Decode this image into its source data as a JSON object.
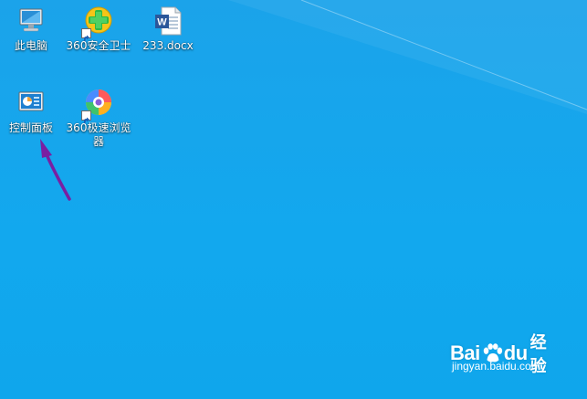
{
  "desktop": {
    "icons": [
      {
        "label": "此电脑",
        "icon": "computer-icon"
      },
      {
        "label": "360安全卫士",
        "icon": "360-security-icon"
      },
      {
        "label": "233.docx",
        "icon": "word-document-icon"
      },
      {
        "label": "控制面板",
        "icon": "control-panel-icon"
      },
      {
        "label": "360极速浏览器",
        "icon": "360-browser-icon"
      }
    ]
  },
  "annotation": {
    "color": "#7a1fa2"
  },
  "watermark": {
    "brand_left": "Bai",
    "brand_right": "du",
    "brand_cn": "经验",
    "url": "jingyan.baidu.com"
  },
  "colors": {
    "desktop_bg": "#12a8ee"
  }
}
